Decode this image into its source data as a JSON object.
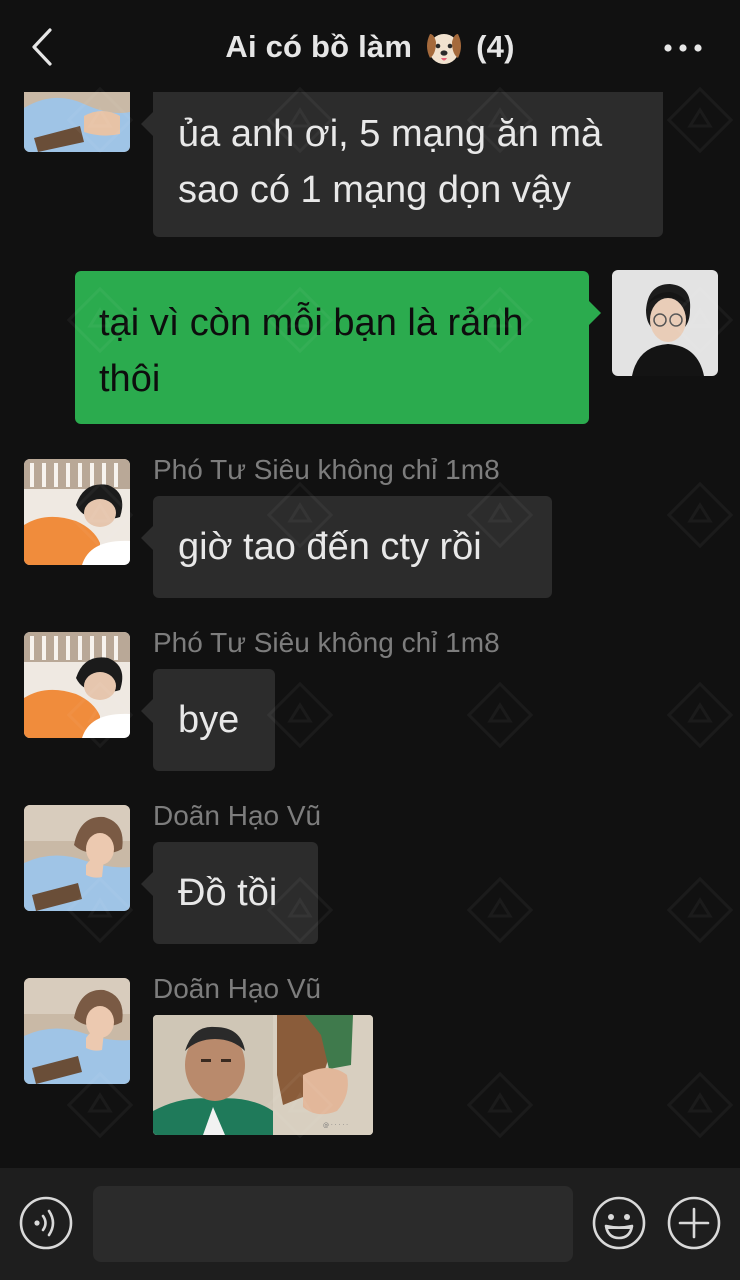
{
  "header": {
    "title": "Ai có bồ làm",
    "title_emoji": "dog-face-emoji",
    "member_count": "(4)",
    "back_icon": "chevron-left-icon",
    "more_icon": "more-dots-icon"
  },
  "messages": [
    {
      "side": "left",
      "sender": "",
      "lines": [
        "ủa anh ơi, 5 mạng ăn mà",
        "sao có 1 mạng dọn vậy"
      ],
      "avatar": "avatar-doan-hao-vu"
    },
    {
      "side": "right",
      "sender": "",
      "lines": [
        "tại vì còn mỗi bạn là rảnh",
        "thôi"
      ],
      "avatar": "avatar-self"
    },
    {
      "side": "left",
      "sender": "Phó Tư Siêu không chỉ 1m8",
      "lines": [
        "giờ tao đến cty rồi"
      ],
      "avatar": "avatar-pho-tu-sieu"
    },
    {
      "side": "left",
      "sender": "Phó Tư Siêu không chỉ 1m8",
      "lines": [
        "bye"
      ],
      "avatar": "avatar-pho-tu-sieu"
    },
    {
      "side": "left",
      "sender": "Doãn Hạo Vũ",
      "lines": [
        "Đồ tồi"
      ],
      "avatar": "avatar-doan-hao-vu"
    },
    {
      "side": "left",
      "sender": "Doãn Hạo Vũ",
      "type": "image",
      "lines": [],
      "avatar": "avatar-doan-hao-vu"
    }
  ],
  "input": {
    "value": "",
    "placeholder": ""
  },
  "bottom_icons": {
    "voice": "voice-icon",
    "emoji": "smiley-icon",
    "plus": "plus-icon"
  },
  "colors": {
    "background": "#111111",
    "bubble_left": "#2c2c2c",
    "bubble_right": "#2bab4e",
    "sender_text": "#7d7d7d",
    "bottom_bar": "#1e1e1e"
  }
}
